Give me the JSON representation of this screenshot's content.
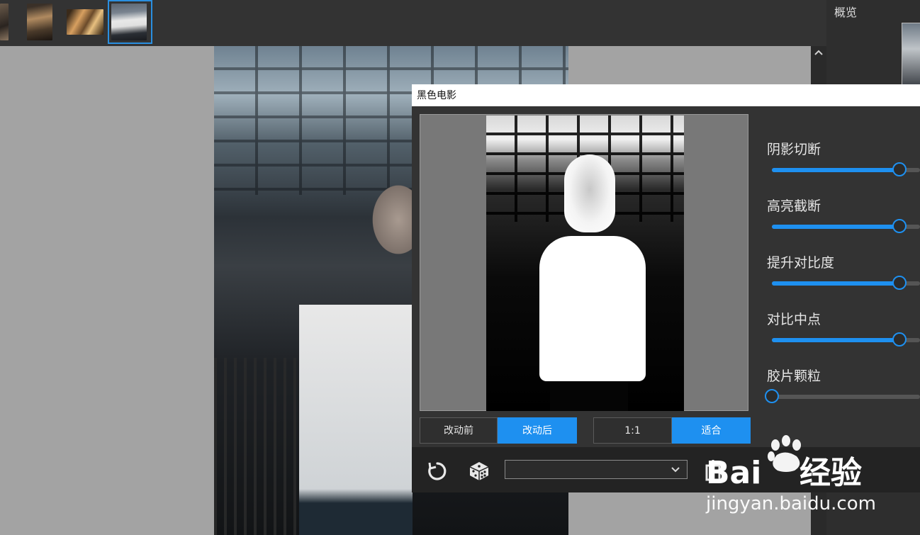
{
  "filmstrip": {
    "thumbnails": [
      {
        "name": "thumb-1",
        "selected": false
      },
      {
        "name": "thumb-2",
        "selected": false
      },
      {
        "name": "thumb-3",
        "selected": false
      },
      {
        "name": "thumb-4",
        "selected": true
      }
    ]
  },
  "overview_panel": {
    "title": "概览"
  },
  "dialog": {
    "title": "黑色电影",
    "compare_buttons": [
      {
        "label": "改动前",
        "active": false
      },
      {
        "label": "改动后",
        "active": true
      }
    ],
    "zoom_buttons": [
      {
        "label": "1:1",
        "active": false
      },
      {
        "label": "适合",
        "active": true
      }
    ],
    "sliders": [
      {
        "label": "阴影切断",
        "value": 0.86
      },
      {
        "label": "高亮截断",
        "value": 0.86
      },
      {
        "label": "提升对比度",
        "value": 0.86
      },
      {
        "label": "对比中点",
        "value": 0.86
      },
      {
        "label": "胶片颗粒",
        "value": 0.0
      }
    ],
    "preset_select": {
      "value": ""
    },
    "icons": {
      "reset": "reset-icon",
      "random": "dice-icon",
      "dropdown": "chevron-down-icon",
      "export": "export-icon"
    }
  },
  "watermark": {
    "text": "jingyan.baidu.com",
    "logo": "Bai du 经验"
  },
  "colors": {
    "accent": "#1e90f0",
    "panel": "#333333",
    "dark": "#232323"
  }
}
